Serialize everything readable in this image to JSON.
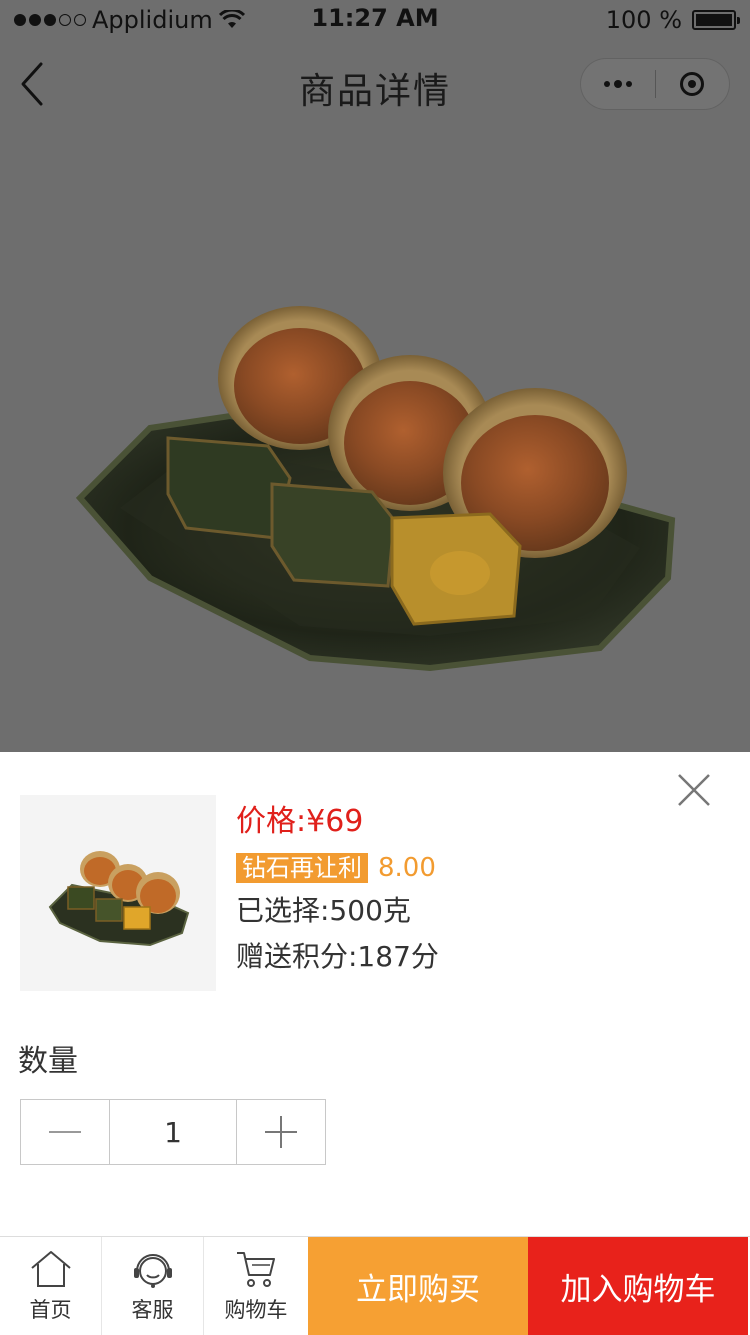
{
  "status_bar": {
    "carrier": "Applidium",
    "time": "11:27 AM",
    "battery": "100 %"
  },
  "nav": {
    "title": "商品详情"
  },
  "icons": {
    "back": "chevron-left-icon",
    "more": "more-dots-icon",
    "close_app": "target-icon",
    "close_sheet": "close-icon",
    "minus": "minus-icon",
    "plus": "plus-icon",
    "home": "home-icon",
    "service": "headset-icon",
    "cart": "cart-icon"
  },
  "product": {
    "price": "价格:¥69",
    "promo_badge": "钻石再让利",
    "promo_value": "8.00",
    "selected": "已选择:500克",
    "points": "赠送积分:187分"
  },
  "quantity": {
    "label": "数量",
    "value": "1"
  },
  "bottom_bar": {
    "home": "首页",
    "service": "客服",
    "cart": "购物车",
    "buy_now": "立即购买",
    "add_to_cart": "加入购物车"
  },
  "colors": {
    "price_red": "#e0201b",
    "promo_orange": "#f29b30",
    "buy_now_bg": "#f6a033",
    "add_cart_bg": "#e8221b",
    "overlay": "#6e6e6e"
  }
}
